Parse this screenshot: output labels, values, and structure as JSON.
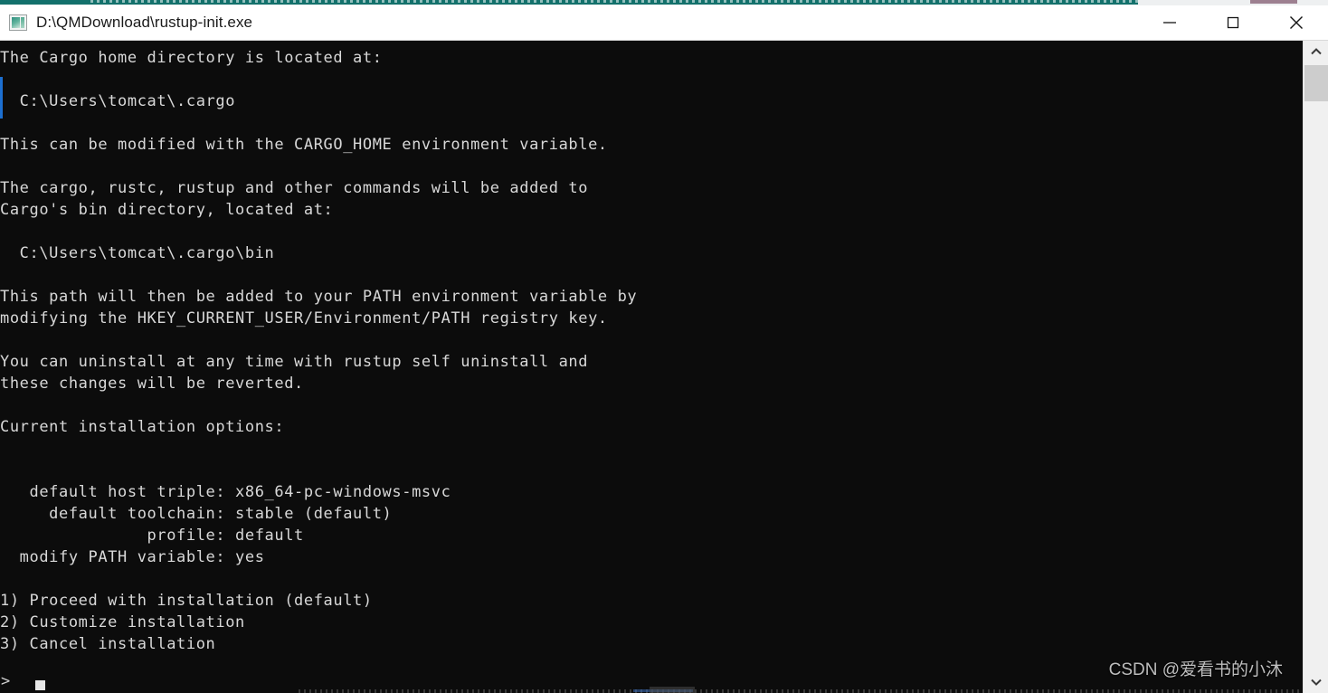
{
  "window": {
    "title": "D:\\QMDownload\\rustup-init.exe",
    "icon": "app-image-icon",
    "minimize_label": "Minimize",
    "maximize_label": "Maximize",
    "close_label": "Close",
    "background_color": "#0c0c0c",
    "text_color": "#d8d8d8",
    "titlebar_color": "#ffffff"
  },
  "console": {
    "body": "The Cargo home directory is located at:\n\n  C:\\Users\\tomcat\\.cargo\n\nThis can be modified with the CARGO_HOME environment variable.\n\nThe cargo, rustc, rustup and other commands will be added to\nCargo's bin directory, located at:\n\n  C:\\Users\\tomcat\\.cargo\\bin\n\nThis path will then be added to your PATH environment variable by\nmodifying the HKEY_CURRENT_USER/Environment/PATH registry key.\n\nYou can uninstall at any time with rustup self uninstall and\nthese changes will be reverted.\n\nCurrent installation options:\n\n\n   default host triple: x86_64-pc-windows-msvc\n     default toolchain: stable (default)\n               profile: default\n  modify PATH variable: yes\n\n1) Proceed with installation (default)\n2) Customize installation\n3) Cancel installation",
    "lines": [
      "The Cargo home directory is located at:",
      "",
      "  C:\\Users\\tomcat\\.cargo",
      "",
      "This can be modified with the CARGO_HOME environment variable.",
      "",
      "The cargo, rustc, rustup and other commands will be added to",
      "Cargo's bin directory, located at:",
      "",
      "  C:\\Users\\tomcat\\.cargo\\bin",
      "",
      "This path will then be added to your PATH environment variable by",
      "modifying the HKEY_CURRENT_USER/Environment/PATH registry key.",
      "",
      "You can uninstall at any time with rustup self uninstall and",
      "these changes will be reverted.",
      "",
      "Current installation options:",
      "",
      "",
      "   default host triple: x86_64-pc-windows-msvc",
      "     default toolchain: stable (default)",
      "               profile: default",
      "  modify PATH variable: yes",
      "",
      "1) Proceed with installation (default)",
      "2) Customize installation",
      "3) Cancel installation"
    ],
    "install_options": [
      {
        "label": "default host triple",
        "value": "x86_64-pc-windows-msvc"
      },
      {
        "label": "default toolchain",
        "value": "stable (default)"
      },
      {
        "label": "profile",
        "value": "default"
      },
      {
        "label": "modify PATH variable",
        "value": "yes"
      }
    ],
    "menu_choices": [
      "1) Proceed with installation (default)",
      "2) Customize installation",
      "3) Cancel installation"
    ],
    "prompt_symbol": ">",
    "prompt_input": ""
  },
  "scrollbar": {
    "up_arrow": "chevron-up-icon",
    "down_arrow": "chevron-down-icon",
    "thumb_label": "scroll-thumb"
  },
  "watermark": {
    "text": "CSDN @爱看书的小沐"
  }
}
